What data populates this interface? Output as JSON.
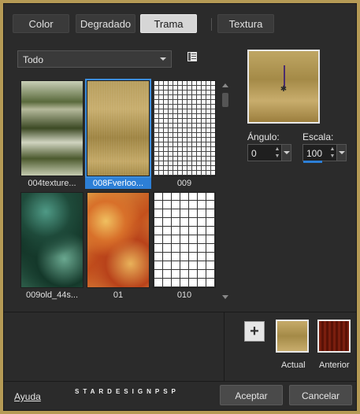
{
  "tabs": [
    {
      "label": "Color",
      "active": false
    },
    {
      "label": "Degradado",
      "active": false
    },
    {
      "label": "Trama",
      "active": true
    },
    {
      "label": "Textura",
      "active": false
    }
  ],
  "category": {
    "selected": "Todo"
  },
  "patterns": [
    {
      "caption": "004texture...",
      "selected": false,
      "style": "greenblur"
    },
    {
      "caption": "008Fverloo...",
      "selected": true,
      "style": "gold"
    },
    {
      "caption": "009",
      "selected": false,
      "style": "finegrid"
    },
    {
      "caption": "009old_44s...",
      "selected": false,
      "style": "teal"
    },
    {
      "caption": "01",
      "selected": false,
      "style": "orange"
    },
    {
      "caption": "010",
      "selected": false,
      "style": "widegrid"
    }
  ],
  "controls": {
    "angle_label": "Ángulo:",
    "angle_value": "0",
    "scale_label": "Escala:",
    "scale_value": "100"
  },
  "swatches": {
    "actual_label": "Actual",
    "anterior_label": "Anterior"
  },
  "footer": {
    "help": "Ayuda",
    "brand": "STARDESIGNPSP",
    "ok": "Aceptar",
    "cancel": "Cancelar"
  },
  "colors": {
    "accent": "#2d7fd6",
    "frame": "#b59a55",
    "panel": "#2b2b2b"
  }
}
